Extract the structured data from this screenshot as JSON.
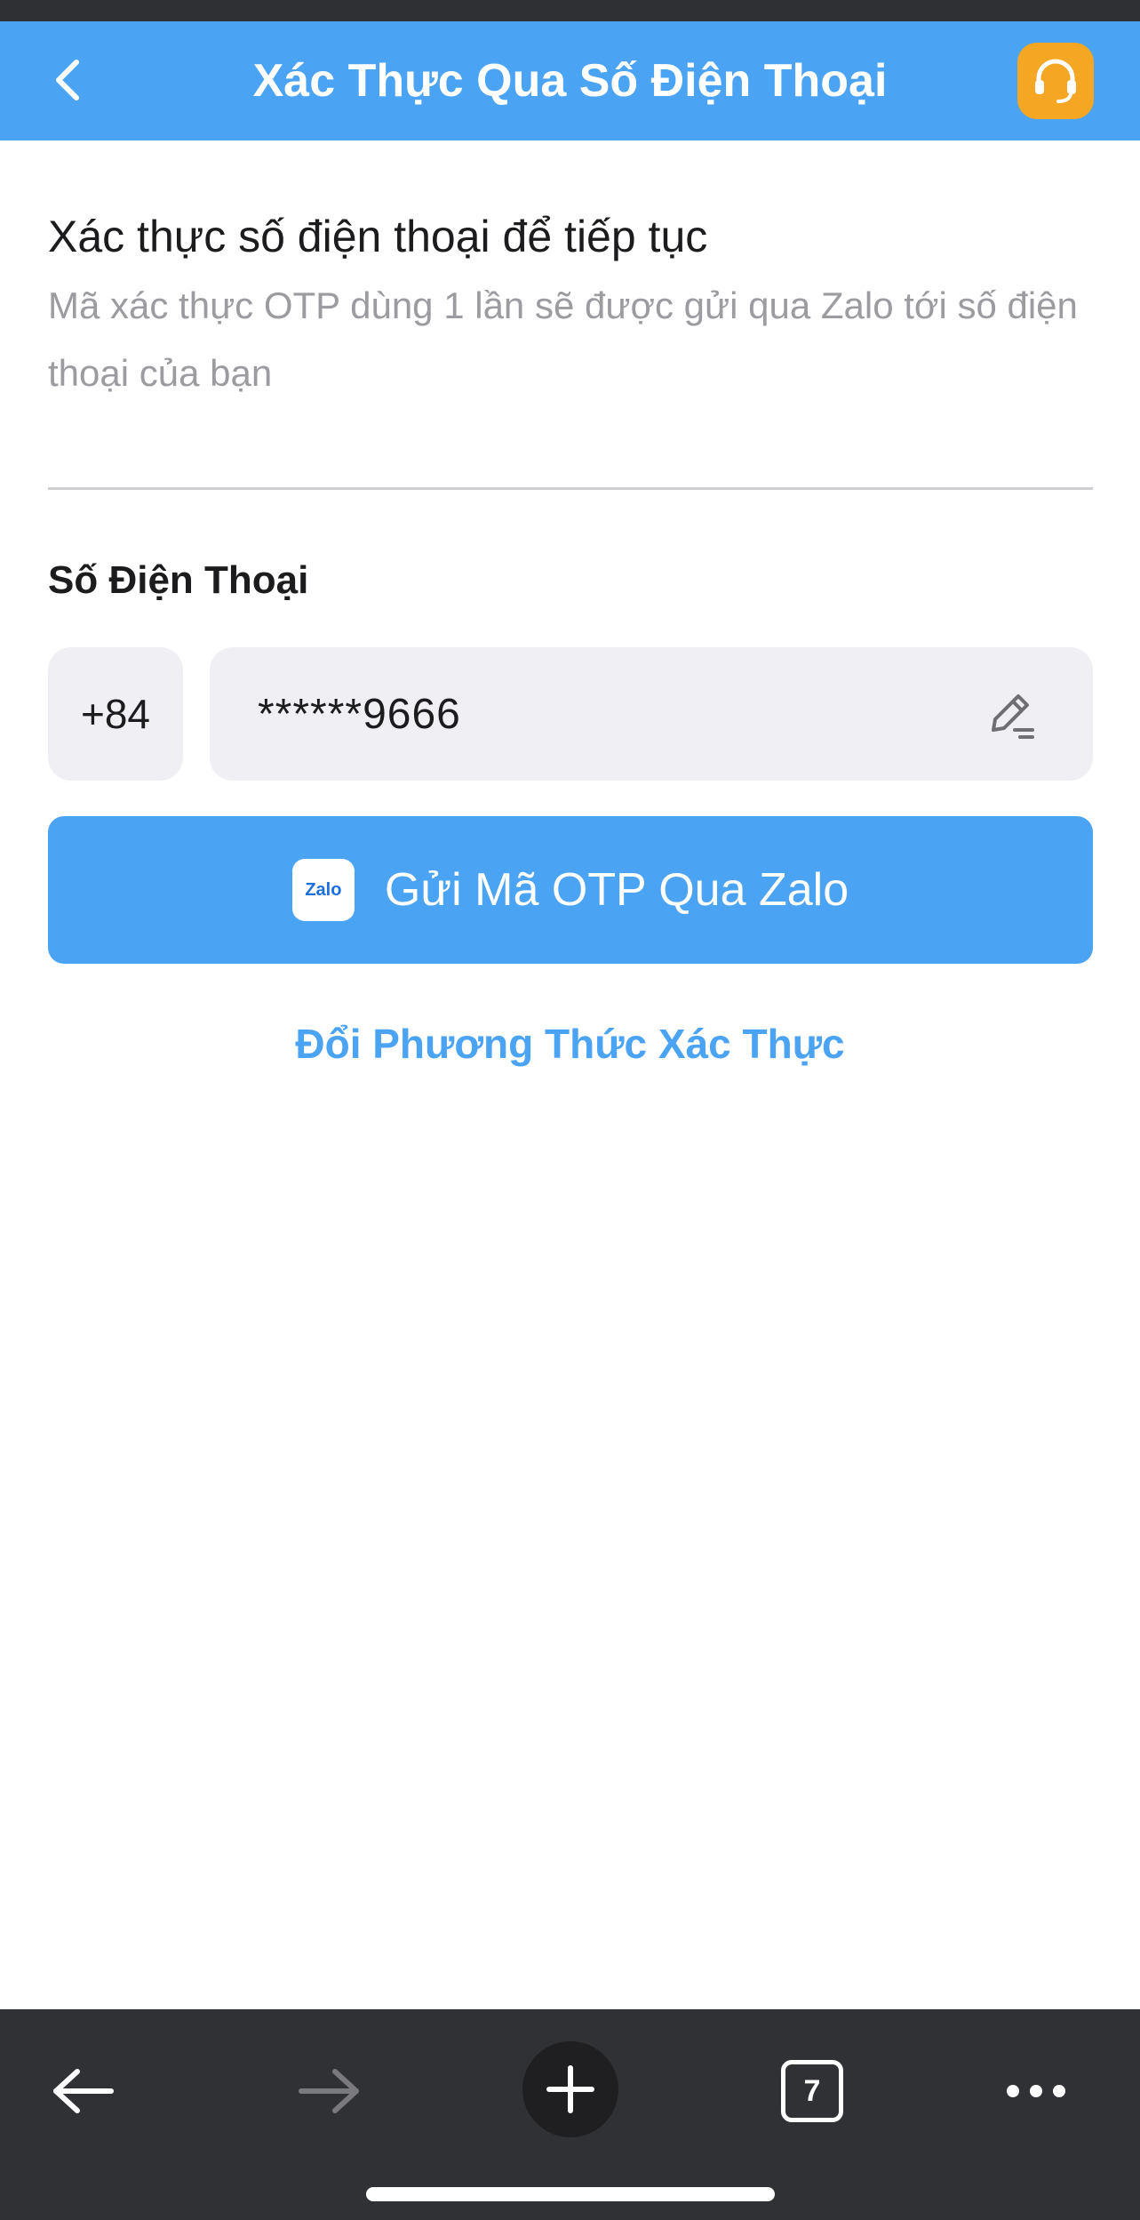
{
  "header": {
    "title": "Xác Thực Qua Số Điện Thoại"
  },
  "intro": {
    "title": "Xác thực số điện thoại để tiếp tục",
    "description": "Mã xác thực OTP dùng 1 lần sẽ được gửi qua Zalo tới số điện thoại của bạn"
  },
  "phone": {
    "label": "Số Điện Thoại",
    "country_code": "+84",
    "value": "******9666"
  },
  "send_button": {
    "logo_text": "Zalo",
    "label": "Gửi Mã OTP Qua Zalo"
  },
  "change_method": {
    "label": "Đổi Phương Thức Xác Thực"
  },
  "browser_bar": {
    "tab_count": "7"
  },
  "icons": {
    "back": "chevron-left-icon",
    "support": "headset-icon",
    "edit": "pencil-icon",
    "nav_back": "arrow-left-icon",
    "nav_forward": "arrow-right-icon",
    "new_tab": "plus-icon",
    "more": "more-dots-icon"
  },
  "colors": {
    "primary": "#4aa3f3",
    "support": "#f5a623",
    "field_bg": "#f0eff4",
    "muted_text": "#9b9ba0",
    "browser_bar": "#303134"
  }
}
